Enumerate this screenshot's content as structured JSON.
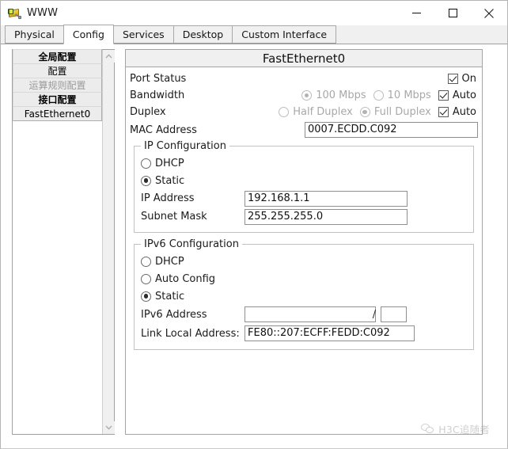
{
  "window": {
    "title": "WWW",
    "app_icon": "server-device-icon",
    "minimize_label": "Minimize",
    "maximize_label": "Maximize",
    "close_label": "Close"
  },
  "tabs": [
    {
      "label": "Physical",
      "active": false
    },
    {
      "label": "Config",
      "active": true
    },
    {
      "label": "Services",
      "active": false
    },
    {
      "label": "Desktop",
      "active": false
    },
    {
      "label": "Custom Interface",
      "active": false
    }
  ],
  "sidebar": {
    "items": [
      {
        "label": "全局配置",
        "style": "bold"
      },
      {
        "label": "配置",
        "style": "normal"
      },
      {
        "label": "运算规则配置",
        "style": "dim"
      },
      {
        "label": "接口配置",
        "style": "bold"
      },
      {
        "label": "FastEthernet0",
        "style": "normal"
      }
    ],
    "scroll_up_icon": "chevron-up-icon",
    "scroll_down_icon": "chevron-down-icon"
  },
  "panel": {
    "header": "FastEthernet0",
    "port_status": {
      "label": "Port Status",
      "checkbox_label": "On",
      "checked": true
    },
    "bandwidth": {
      "label": "Bandwidth",
      "option_100": "100 Mbps",
      "option_10": "10 Mbps",
      "selected": "100 Mbps",
      "auto_label": "Auto",
      "auto_checked": true
    },
    "duplex": {
      "label": "Duplex",
      "option_half": "Half Duplex",
      "option_full": "Full Duplex",
      "selected": "Full Duplex",
      "auto_label": "Auto",
      "auto_checked": true
    },
    "mac": {
      "label": "MAC Address",
      "value": "0007.ECDD.C092"
    },
    "ip_config": {
      "title": "IP Configuration",
      "dhcp_label": "DHCP",
      "static_label": "Static",
      "selected": "Static",
      "ip_address_label": "IP Address",
      "ip_address_value": "192.168.1.1",
      "subnet_mask_label": "Subnet Mask",
      "subnet_mask_value": "255.255.255.0"
    },
    "ipv6_config": {
      "title": "IPv6 Configuration",
      "dhcp_label": "DHCP",
      "auto_config_label": "Auto Config",
      "static_label": "Static",
      "selected": "Static",
      "ipv6_address_label": "IPv6 Address",
      "ipv6_address_value": "",
      "ipv6_prefix_value": "",
      "ipv6_separator": "/",
      "link_local_label": "Link Local Address:",
      "link_local_value": "FE80::207:ECFF:FEDD:C092"
    }
  },
  "watermark": {
    "icon": "wechat-icon",
    "text": "H3C追随者"
  }
}
